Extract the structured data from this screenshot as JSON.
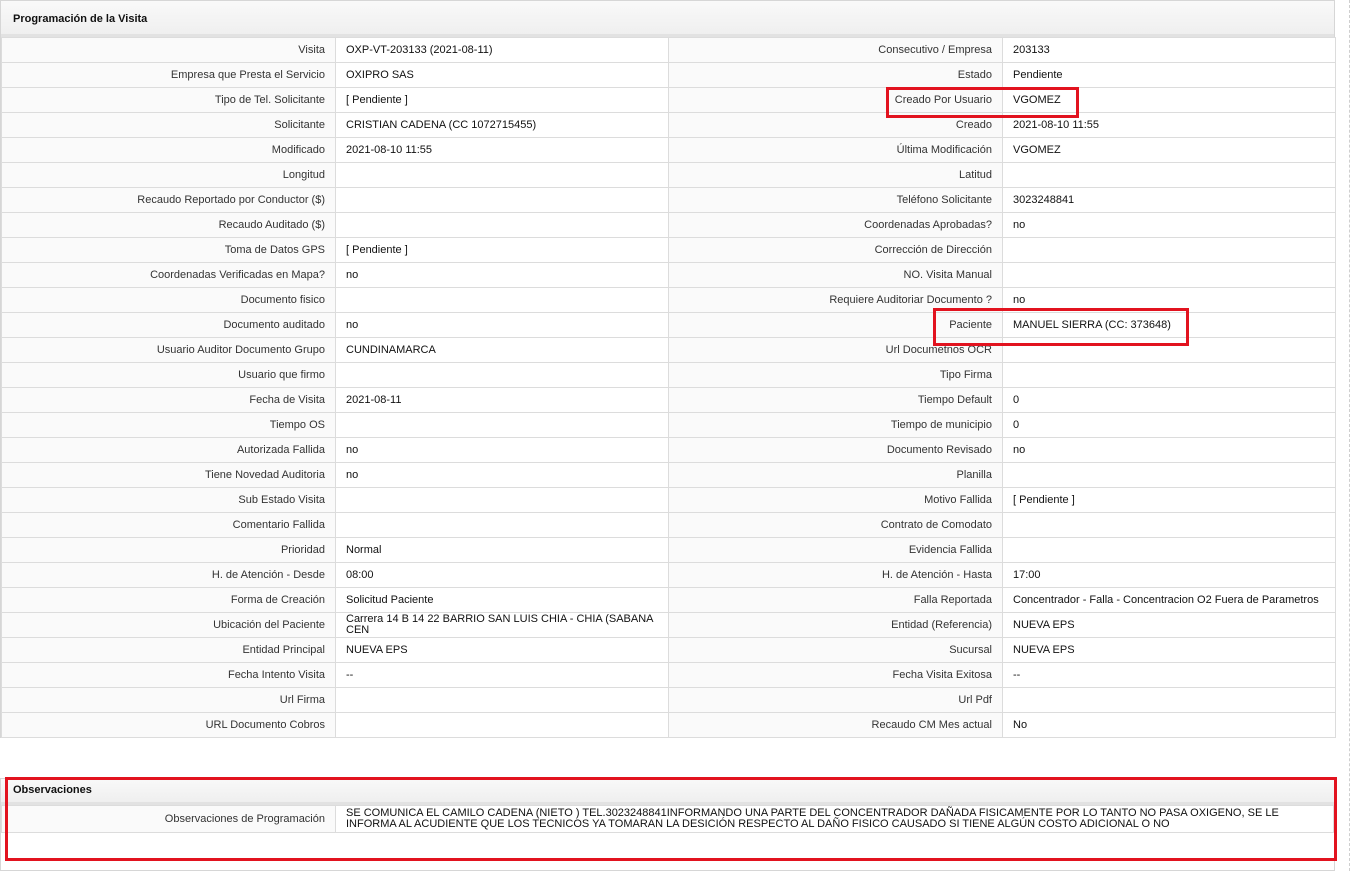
{
  "main": {
    "header": "Programación de la Visita",
    "rows": [
      {
        "l1": "Visita",
        "v1": "OXP-VT-203133 (2021-08-11)",
        "l2": "Consecutivo / Empresa",
        "v2": "203133"
      },
      {
        "l1": "Empresa que Presta el Servicio",
        "v1": "OXIPRO SAS",
        "l2": "Estado",
        "v2": "Pendiente"
      },
      {
        "l1": "Tipo de Tel. Solicitante",
        "v1": "[ Pendiente ]",
        "l2": "Creado Por Usuario",
        "v2": "VGOMEZ"
      },
      {
        "l1": "Solicitante",
        "v1": "CRISTIAN CADENA (CC 1072715455)",
        "l2": "Creado",
        "v2": "2021-08-10 11:55"
      },
      {
        "l1": "Modificado",
        "v1": "2021-08-10 11:55",
        "l2": "Última Modificación",
        "v2": " VGOMEZ"
      },
      {
        "l1": "Longitud",
        "v1": "",
        "l2": "Latitud",
        "v2": ""
      },
      {
        "l1": "Recaudo Reportado por Conductor ($)",
        "v1": "",
        "l2": "Teléfono Solicitante",
        "v2": "3023248841"
      },
      {
        "l1": "Recaudo Auditado ($)",
        "v1": "",
        "l2": "Coordenadas Aprobadas?",
        "v2": " no"
      },
      {
        "l1": "Toma de Datos GPS",
        "v1": "[ Pendiente ]",
        "l2": "Corrección de Dirección",
        "v2": ""
      },
      {
        "l1": "Coordenadas Verificadas en Mapa?",
        "v1": " no",
        "l2": "NO. Visita Manual",
        "v2": ""
      },
      {
        "l1": "Documento fisico",
        "v1": "",
        "l2": "Requiere Auditoriar Documento ?",
        "v2": " no"
      },
      {
        "l1": "Documento auditado",
        "v1": " no",
        "l2": "Paciente",
        "v2": "MANUEL SIERRA (CC: 373648)"
      },
      {
        "l1": "Usuario Auditor Documento Grupo",
        "v1": "CUNDINAMARCA",
        "l2": "Url Documetnos OCR",
        "v2": ""
      },
      {
        "l1": "Usuario que firmo",
        "v1": "",
        "l2": "Tipo Firma",
        "v2": ""
      },
      {
        "l1": "Fecha de Visita",
        "v1": " 2021-08-11",
        "l2": "Tiempo Default",
        "v2": "0"
      },
      {
        "l1": "Tiempo OS",
        "v1": "",
        "l2": "Tiempo de municipio",
        "v2": "0"
      },
      {
        "l1": "Autorizada Fallida",
        "v1": " no",
        "l2": "Documento Revisado",
        "v2": " no"
      },
      {
        "l1": "Tiene Novedad Auditoria",
        "v1": " no",
        "l2": "Planilla",
        "v2": ""
      },
      {
        "l1": "Sub Estado Visita",
        "v1": "",
        "l2": "Motivo Fallida",
        "v2": "[ Pendiente ]"
      },
      {
        "l1": "Comentario Fallida",
        "v1": "",
        "l2": "Contrato de Comodato",
        "v2": ""
      },
      {
        "l1": "Prioridad",
        "v1": "Normal",
        "l2": "Evidencia Fallida",
        "v2": ""
      },
      {
        "l1": "H. de Atención - Desde",
        "v1": "08:00",
        "l2": "H. de Atención - Hasta",
        "v2": "17:00"
      },
      {
        "l1": "Forma de Creación",
        "v1": "Solicitud Paciente",
        "l2": "Falla Reportada",
        "v2": "Concentrador - Falla - Concentracion O2 Fuera de Parametros"
      },
      {
        "l1": "Ubicación del Paciente",
        "v1": "Carrera 14 B 14 22 BARRIO SAN LUIS CHIA - CHIA (SABANA CEN",
        "l2": "Entidad (Referencia)",
        "v2": "NUEVA EPS"
      },
      {
        "l1": "Entidad Principal",
        "v1": "NUEVA EPS",
        "l2": "Sucursal",
        "v2": "NUEVA EPS"
      },
      {
        "l1": "Fecha Intento Visita",
        "v1": " --",
        "l2": "Fecha Visita Exitosa",
        "v2": " --"
      },
      {
        "l1": "Url Firma",
        "v1": "",
        "l2": "Url Pdf",
        "v2": ""
      },
      {
        "l1": "URL Documento Cobros",
        "v1": "",
        "l2": "Recaudo CM Mes actual",
        "v2": "No"
      }
    ]
  },
  "observaciones": {
    "header": "Observaciones",
    "label": "Observaciones de Programación",
    "value": "  SE COMUNICA EL CAMILO CADENA (NIETO ) TEL.3023248841INFORMANDO UNA PARTE DEL CONCENTRADOR DAÑADA FISICAMENTE POR LO TANTO NO PASA OXIGENO, SE LE INFORMA AL ACUDIENTE QUE LOS TECNICOS YA TOMARAN LA DESICIÓN RESPECTO AL DAÑO FISICO CAUSADO SI TIENE ALGÚN COSTO ADICIONAL O NO"
  },
  "colors": {
    "highlight": "#e2131f",
    "header_bg": "#efefef",
    "border": "#dcdcdc"
  }
}
